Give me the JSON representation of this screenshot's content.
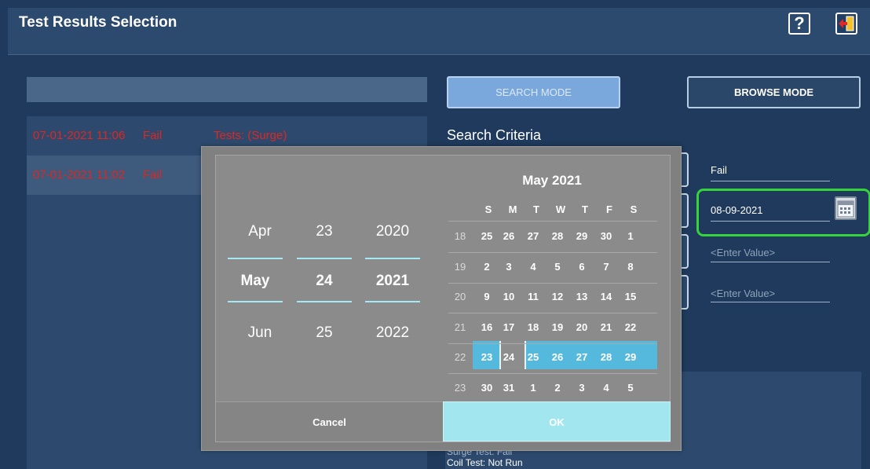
{
  "header": {
    "title": "Test Results Selection",
    "help_glyph": "?",
    "help_icon": "question-icon",
    "exit_icon": "exit-door-icon"
  },
  "results": [
    {
      "datetime": "07-01-2021 11:06",
      "status": "Fail",
      "tests": "Tests: (Surge)"
    },
    {
      "datetime": "07-01-2021 11:02",
      "status": "Fail"
    }
  ],
  "modes": {
    "search": "SEARCH MODE",
    "browse": "BROWSE MODE"
  },
  "search": {
    "heading": "Search Criteria",
    "result_value": "Fail",
    "date_value": "08-09-2021",
    "placeholder1": "<Enter Value>",
    "placeholder2": "<Enter Value>"
  },
  "detail": {
    "line1": "Surge Test: Fail",
    "line2": "Coil Test: Not Run"
  },
  "date_picker": {
    "months": [
      "Apr",
      "May",
      "Jun"
    ],
    "days": [
      "23",
      "24",
      "25"
    ],
    "years": [
      "2020",
      "2021",
      "2022"
    ],
    "calendar_title": "May 2021",
    "weekdays": [
      "S",
      "M",
      "T",
      "W",
      "T",
      "F",
      "S"
    ],
    "weeks": [
      {
        "num": "18",
        "days": [
          "25",
          "26",
          "27",
          "28",
          "29",
          "30",
          "1"
        ]
      },
      {
        "num": "19",
        "days": [
          "2",
          "3",
          "4",
          "5",
          "6",
          "7",
          "8"
        ]
      },
      {
        "num": "20",
        "days": [
          "9",
          "10",
          "11",
          "12",
          "13",
          "14",
          "15"
        ]
      },
      {
        "num": "21",
        "days": [
          "16",
          "17",
          "18",
          "19",
          "20",
          "21",
          "22"
        ]
      },
      {
        "num": "22",
        "days": [
          "23",
          "24",
          "25",
          "26",
          "27",
          "28",
          "29"
        ]
      },
      {
        "num": "23",
        "days": [
          "30",
          "31",
          "1",
          "2",
          "3",
          "4",
          "5"
        ]
      }
    ],
    "selected_week": "22",
    "selected_day": "24",
    "cancel": "Cancel",
    "ok": "OK"
  },
  "colors": {
    "accent": "#55b9de",
    "fail": "#e0261f",
    "highlight": "#35d43a"
  }
}
